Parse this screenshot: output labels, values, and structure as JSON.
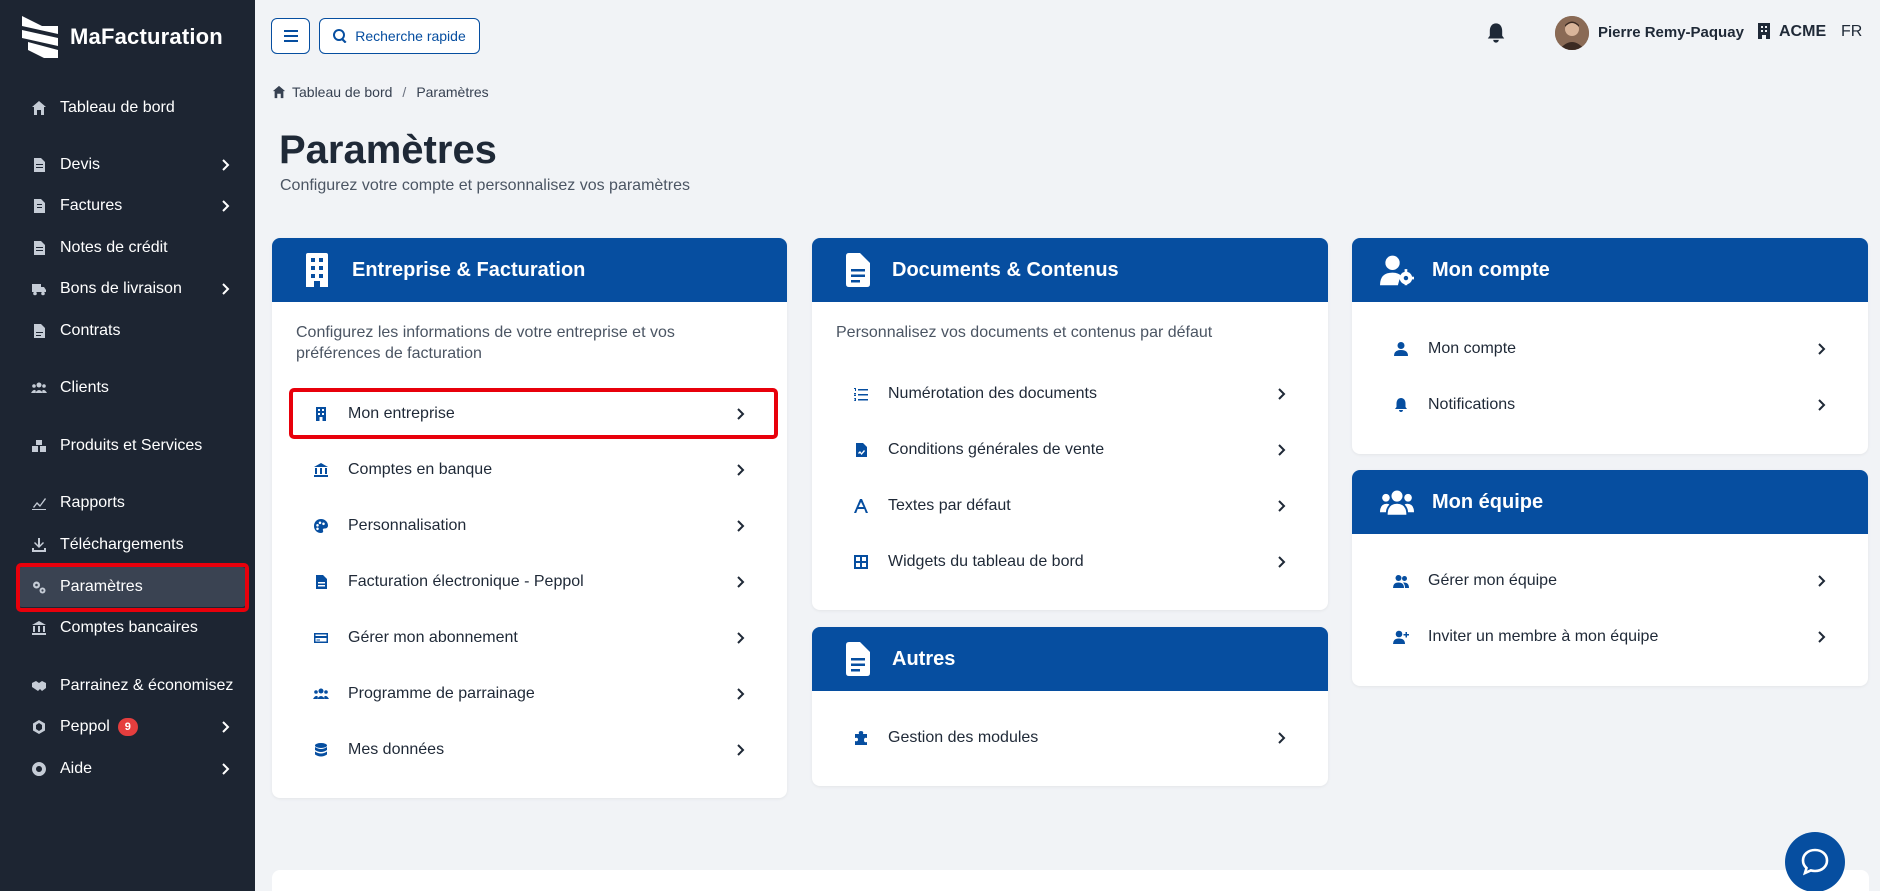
{
  "brand": {
    "name": "MaFacturation"
  },
  "sidebar": {
    "items": [
      {
        "label": "Tableau de bord",
        "icon": "home-icon",
        "chevron": false
      },
      {
        "label": "Devis",
        "icon": "file-icon",
        "chevron": true
      },
      {
        "label": "Factures",
        "icon": "invoice-icon",
        "chevron": true
      },
      {
        "label": "Notes de crédit",
        "icon": "file-icon",
        "chevron": false
      },
      {
        "label": "Bons de livraison",
        "icon": "truck-icon",
        "chevron": true
      },
      {
        "label": "Contrats",
        "icon": "contract-icon",
        "chevron": false
      },
      {
        "label": "Clients",
        "icon": "users-icon",
        "chevron": false
      },
      {
        "label": "Produits et Services",
        "icon": "boxes-icon",
        "chevron": false
      },
      {
        "label": "Rapports",
        "icon": "chart-icon",
        "chevron": false
      },
      {
        "label": "Téléchargements",
        "icon": "download-icon",
        "chevron": false
      },
      {
        "label": "Paramètres",
        "icon": "gears-icon",
        "chevron": false,
        "active": true
      },
      {
        "label": "Comptes bancaires",
        "icon": "bank-icon",
        "chevron": false
      },
      {
        "label": "Parrainez & économisez",
        "icon": "handshake-icon",
        "chevron": false
      },
      {
        "label": "Peppol",
        "icon": "peppol-icon",
        "chevron": true,
        "badge": "9"
      },
      {
        "label": "Aide",
        "icon": "lifebuoy-icon",
        "chevron": true
      }
    ]
  },
  "topbar": {
    "search_label": "Recherche rapide",
    "user_name": "Pierre Remy-Paquay",
    "org_name": "ACME",
    "language": "FR"
  },
  "breadcrumb": {
    "home": "Tableau de bord",
    "separator": "/",
    "current": "Paramètres"
  },
  "page": {
    "title": "Paramètres",
    "subtitle": "Configurez votre compte et personnalisez vos paramètres"
  },
  "cards": {
    "entreprise": {
      "title": "Entreprise & Facturation",
      "description": "Configurez les informations de votre entreprise et vos préférences de facturation",
      "items": [
        "Mon entreprise",
        "Comptes en banque",
        "Personnalisation",
        "Facturation électronique - Peppol",
        "Gérer mon abonnement",
        "Programme de parrainage",
        "Mes données"
      ]
    },
    "documents": {
      "title": "Documents & Contenus",
      "description": "Personnalisez vos documents et contenus par défaut",
      "items": [
        "Numérotation des documents",
        "Conditions générales de vente",
        "Textes par défaut",
        "Widgets du tableau de bord"
      ]
    },
    "autres": {
      "title": "Autres",
      "items": [
        "Gestion des modules"
      ]
    },
    "compte": {
      "title": "Mon compte",
      "items": [
        "Mon compte",
        "Notifications"
      ]
    },
    "equipe": {
      "title": "Mon équipe",
      "items": [
        "Gérer mon équipe",
        "Inviter un membre à mon équipe"
      ]
    }
  },
  "colors": {
    "primary": "#064ea0",
    "sidebar_bg": "#1d2532",
    "highlight": "#e8000b",
    "badge": "#e53e3e"
  }
}
